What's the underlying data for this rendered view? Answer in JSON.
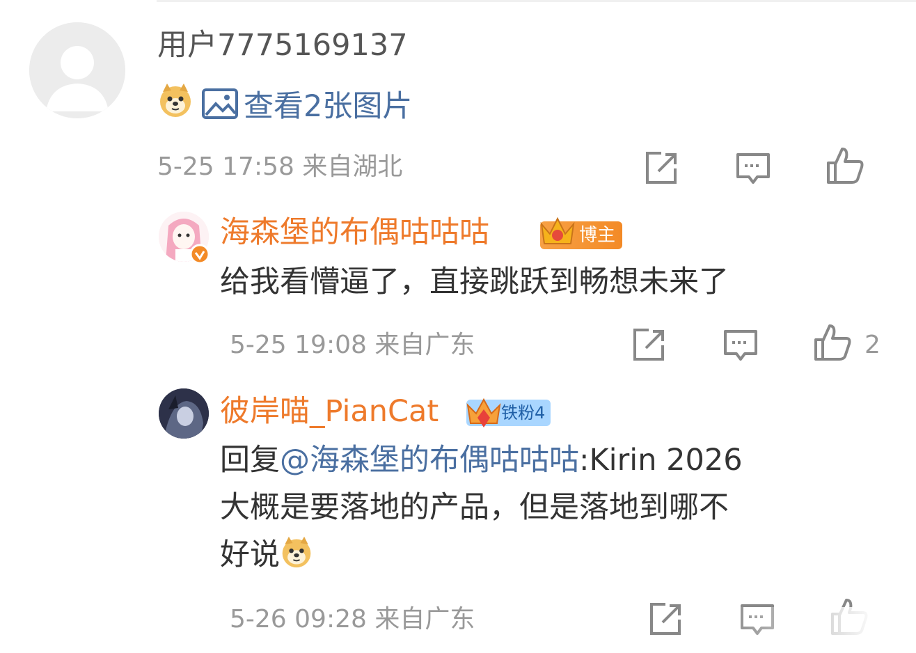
{
  "comment1": {
    "username": "用户7775169137",
    "view_images_label": "查看2张图片",
    "meta": "5-25 17:58 来自湖北"
  },
  "reply1": {
    "username": "海森堡的布偶咕咕咕",
    "badge_label": "博主",
    "text": "给我看懵逼了，直接跳跃到畅想未来了",
    "meta": "5-25 19:08 来自广东",
    "like_count": "2"
  },
  "reply2": {
    "username": "彼岸喵_PianCat",
    "badge_label": "铁粉4",
    "reply_prefix": "回复",
    "mention": "@海森堡的布偶咕咕咕",
    "text_line1": ":Kirin 2026",
    "text_line2": "大概是要落地的产品，但是落地到哪不",
    "text_line3": "好说",
    "meta": "5-26 09:28 来自广东"
  },
  "colors": {
    "username_orange": "#ee7a2b",
    "link_blue": "#4a6fa1",
    "meta_gray": "#999999",
    "blogger_badge": "#f38a26",
    "fan_badge": "#a9d6ff"
  },
  "icons": [
    "share-icon",
    "comment-icon",
    "like-icon",
    "doge-emoji-icon",
    "image-icon",
    "verified-icon",
    "crown-icon"
  ]
}
